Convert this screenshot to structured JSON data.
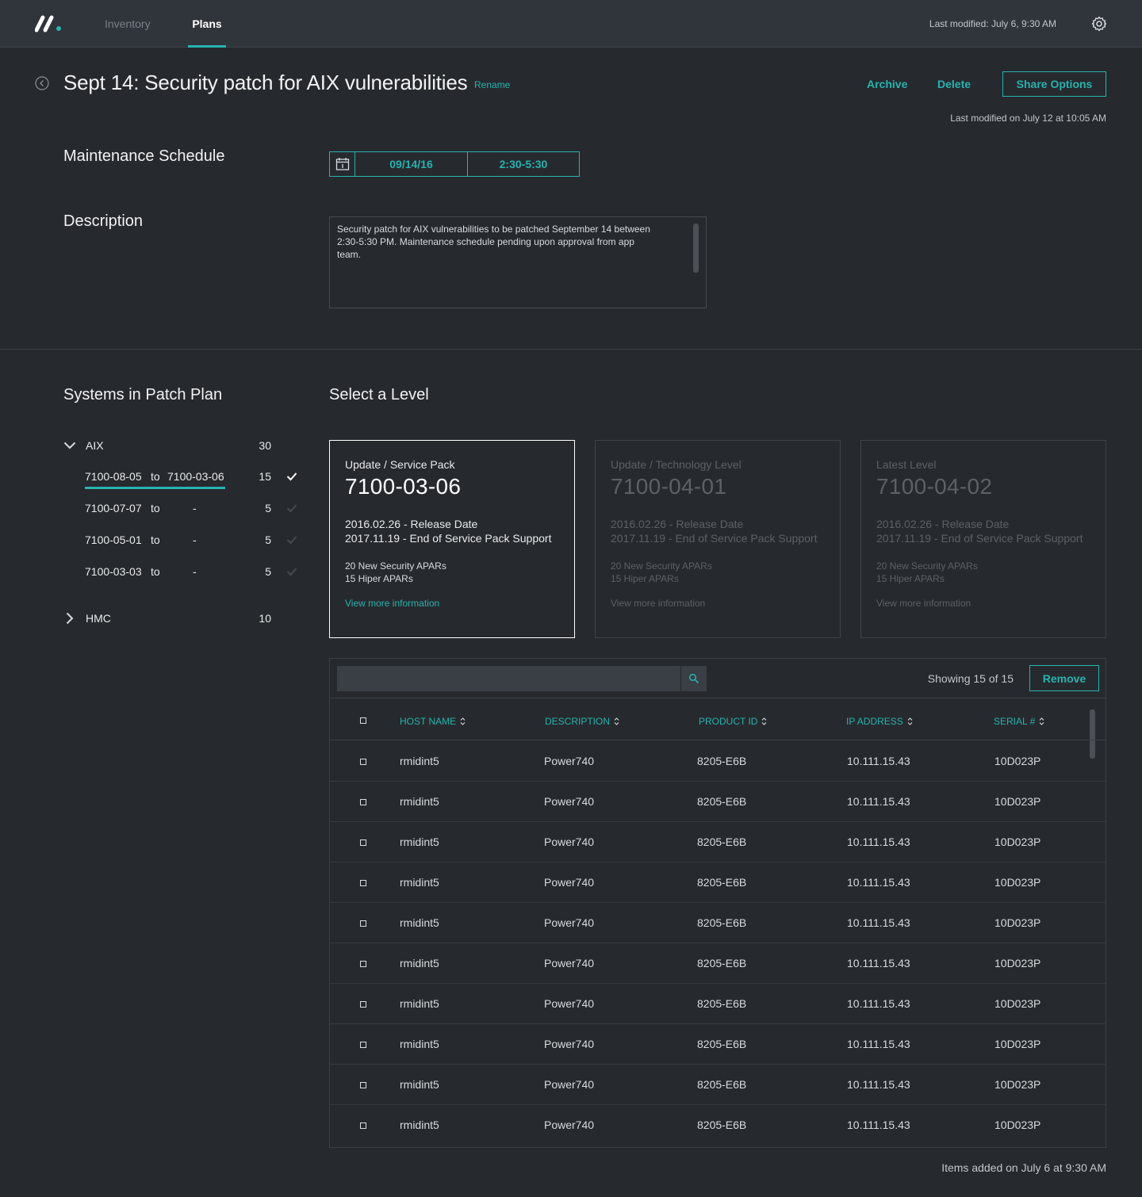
{
  "nav": {
    "tabs": [
      {
        "label": "Inventory"
      },
      {
        "label": "Plans"
      }
    ],
    "last_modified": "Last modified: July 6, 9:30 AM"
  },
  "header": {
    "title": "Sept 14: Security patch for AIX vulnerabilities",
    "rename": "Rename",
    "archive": "Archive",
    "delete": "Delete",
    "share": "Share Options",
    "modified": "Last modified on July 12 at 10:05 AM"
  },
  "schedule": {
    "label": "Maintenance Schedule",
    "date": "09/14/16",
    "time": "2:30-5:30"
  },
  "description": {
    "label": "Description",
    "text": "Security patch for AIX vulnerabilities to be patched September 14 between 2:30-5:30 PM. Maintenance schedule pending upon approval from app team."
  },
  "systems": {
    "label": "Systems in Patch Plan",
    "groups": [
      {
        "name": "AIX",
        "count": "30",
        "items": [
          {
            "from": "7100-08-05",
            "to_word": "to",
            "to": "7100-03-06",
            "count": "15"
          },
          {
            "from": "7100-07-07",
            "to_word": "to",
            "to": "-",
            "count": "5"
          },
          {
            "from": "7100-05-01",
            "to_word": "to",
            "to": "-",
            "count": "5"
          },
          {
            "from": "7100-03-03",
            "to_word": "to",
            "to": "-",
            "count": "5"
          }
        ]
      },
      {
        "name": "HMC",
        "count": "10"
      }
    ]
  },
  "levels": {
    "label": "Select a Level",
    "cards": [
      {
        "type": "Update / Service Pack",
        "version": "7100-03-06",
        "release": "2016.02.26 - Release Date",
        "eos": "2017.11.19 - End of Service Pack Support",
        "security": "20 New Security APARs",
        "hiper": "15 Hiper APARs",
        "link": "View more information"
      },
      {
        "type": "Update / Technology Level",
        "version": "7100-04-01",
        "release": "2016.02.26 - Release Date",
        "eos": "2017.11.19 - End of Service Pack Support",
        "security": "20 New Security APARs",
        "hiper": "15 Hiper APARs",
        "link": "View more information"
      },
      {
        "type": "Latest Level",
        "version": "7100-04-02",
        "release": "2016.02.26 - Release Date",
        "eos": "2017.11.19 - End of Service Pack Support",
        "security": "20 New Security APARs",
        "hiper": "15 Hiper APARs",
        "link": "View more information"
      }
    ]
  },
  "table": {
    "search_value": "",
    "showing": "Showing 15 of 15",
    "remove": "Remove",
    "columns": [
      "HOST NAME",
      "DESCRIPTION",
      "PRODUCT ID",
      "IP ADDRESS",
      "SERIAL #"
    ],
    "rows": [
      [
        "rmidint5",
        "Power740",
        "8205-E6B",
        "10.111.15.43",
        "10D023P"
      ],
      [
        "rmidint5",
        "Power740",
        "8205-E6B",
        "10.111.15.43",
        "10D023P"
      ],
      [
        "rmidint5",
        "Power740",
        "8205-E6B",
        "10.111.15.43",
        "10D023P"
      ],
      [
        "rmidint5",
        "Power740",
        "8205-E6B",
        "10.111.15.43",
        "10D023P"
      ],
      [
        "rmidint5",
        "Power740",
        "8205-E6B",
        "10.111.15.43",
        "10D023P"
      ],
      [
        "rmidint5",
        "Power740",
        "8205-E6B",
        "10.111.15.43",
        "10D023P"
      ],
      [
        "rmidint5",
        "Power740",
        "8205-E6B",
        "10.111.15.43",
        "10D023P"
      ],
      [
        "rmidint5",
        "Power740",
        "8205-E6B",
        "10.111.15.43",
        "10D023P"
      ],
      [
        "rmidint5",
        "Power740",
        "8205-E6B",
        "10.111.15.43",
        "10D023P"
      ],
      [
        "rmidint5",
        "Power740",
        "8205-E6B",
        "10.111.15.43",
        "10D023P"
      ]
    ]
  },
  "footer": {
    "items_added": "Items added on July 6 at 9:30 AM"
  },
  "colors": {
    "accent": "#27b3b0",
    "background": "#262a2e",
    "nav_background": "#30353b"
  }
}
